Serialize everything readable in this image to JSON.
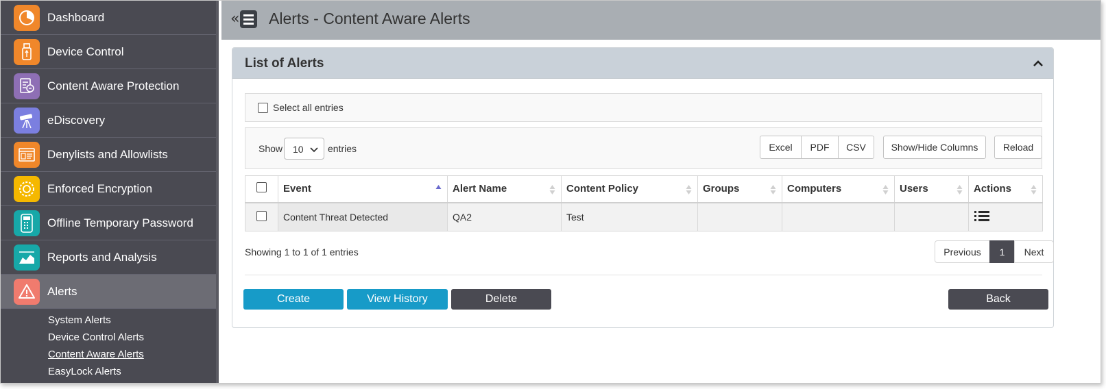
{
  "sidebar": {
    "items": [
      {
        "label": "Dashboard",
        "icon": "dashboard-pie-icon",
        "color": "#f0872a"
      },
      {
        "label": "Device Control",
        "icon": "usb-drive-icon",
        "color": "#f0872a"
      },
      {
        "label": "Content Aware Protection",
        "icon": "document-scan-icon",
        "color": "#8e6fb5"
      },
      {
        "label": "eDiscovery",
        "icon": "telescope-icon",
        "color": "#7b7fe0"
      },
      {
        "label": "Denylists and Allowlists",
        "icon": "list-window-icon",
        "color": "#f0872a"
      },
      {
        "label": "Enforced Encryption",
        "icon": "gear-shield-icon",
        "color": "#f5b800"
      },
      {
        "label": "Offline Temporary Password",
        "icon": "keypad-icon",
        "color": "#17a8a8"
      },
      {
        "label": "Reports and Analysis",
        "icon": "chart-area-icon",
        "color": "#17a8a8"
      },
      {
        "label": "Alerts",
        "icon": "warning-triangle-icon",
        "color": "#f07b6e"
      }
    ],
    "sub_items": [
      {
        "label": "System Alerts"
      },
      {
        "label": "Device Control Alerts"
      },
      {
        "label": "Content Aware Alerts"
      },
      {
        "label": "EasyLock Alerts"
      }
    ]
  },
  "header": {
    "title": "Alerts - Content Aware Alerts"
  },
  "panel": {
    "title": "List of Alerts",
    "select_all_label": "Select all entries",
    "show_label": "Show",
    "page_size": "10",
    "entries_label": "entries",
    "export_buttons": {
      "excel": "Excel",
      "pdf": "PDF",
      "csv": "CSV"
    },
    "show_hide_label": "Show/Hide Columns",
    "reload_label": "Reload",
    "columns": [
      "Event",
      "Alert Name",
      "Content Policy",
      "Groups",
      "Computers",
      "Users",
      "Actions"
    ],
    "rows": [
      {
        "event": "Content Threat Detected",
        "alert_name": "QA2",
        "content_policy": "Test",
        "groups": "",
        "computers": "",
        "users": ""
      }
    ],
    "info": "Showing 1 to 1 of 1 entries",
    "pagination": {
      "previous": "Previous",
      "current": "1",
      "next": "Next"
    },
    "actions": {
      "create": "Create",
      "view_history": "View History",
      "delete": "Delete",
      "back": "Back"
    }
  },
  "colors": {
    "sidebar_bg": "#4a4a52",
    "header_bg": "#a9aeb3",
    "primary_button": "#179bc8",
    "dark_button": "#4a4a52",
    "panel_header": "#c9d1d9"
  }
}
